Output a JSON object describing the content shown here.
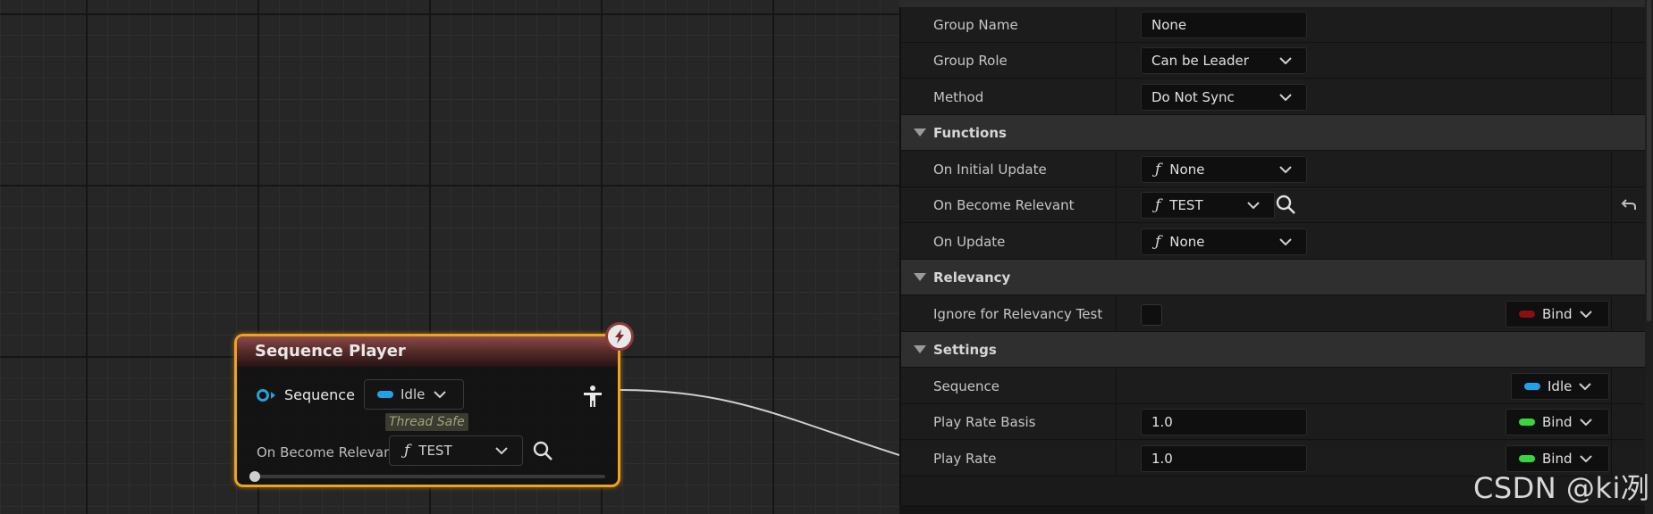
{
  "node": {
    "title": "Sequence Player",
    "sequence_pin_label": "Sequence",
    "sequence_value": "Idle",
    "thread_safe_label": "Thread Safe",
    "on_become_relevant_label": "On Become Relevant",
    "on_become_relevant_value": "TEST",
    "icons": {
      "fast_path": "lightning-bolt-icon",
      "actor": "actor-person-icon",
      "search": "magnifier-icon"
    },
    "colors": {
      "border": "#f0a21b",
      "header": "#8a4a4a",
      "pin": "#2a9fd6"
    }
  },
  "panel": {
    "rows": {
      "group_name": {
        "label": "Group Name",
        "value": "None"
      },
      "group_role": {
        "label": "Group Role",
        "value": "Can be Leader"
      },
      "method": {
        "label": "Method",
        "value": "Do Not Sync"
      }
    },
    "functions": {
      "header": "Functions",
      "on_initial_update": {
        "label": "On Initial Update",
        "value": "None"
      },
      "on_become_relevant": {
        "label": "On Become Relevant",
        "value": "TEST"
      },
      "on_update": {
        "label": "On Update",
        "value": "None"
      }
    },
    "relevancy": {
      "header": "Relevancy",
      "ignore": {
        "label": "Ignore for Relevancy Test",
        "checked": false,
        "bind_label": "Bind"
      }
    },
    "settings": {
      "header": "Settings",
      "sequence": {
        "label": "Sequence",
        "value": "Idle"
      },
      "play_rate_basis": {
        "label": "Play Rate Basis",
        "value": "1.0",
        "bind_label": "Bind"
      },
      "play_rate": {
        "label": "Play Rate",
        "value": "1.0",
        "bind_label": "Bind"
      }
    },
    "colors": {
      "bool_pin": "#8b0f0f",
      "float_pin": "#38d63b",
      "object_pin": "#1fa3e8"
    }
  },
  "watermark": "CSDN @ki冽"
}
